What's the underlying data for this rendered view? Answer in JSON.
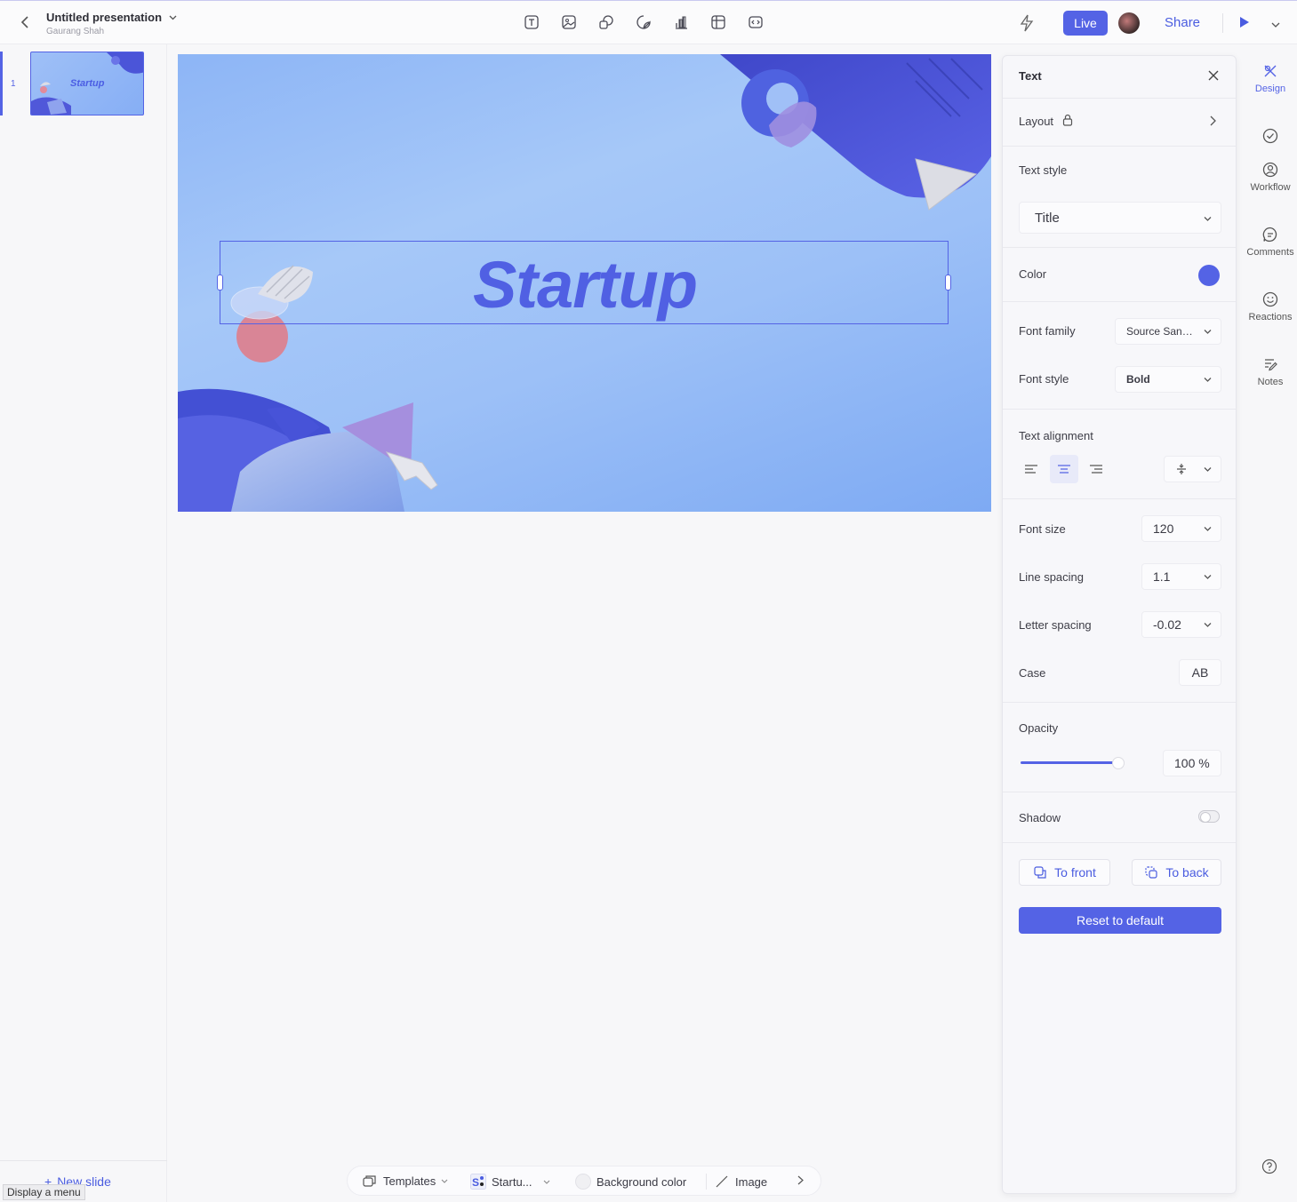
{
  "header": {
    "title": "Untitled presentation",
    "owner": "Gaurang Shah",
    "live_label": "Live",
    "share_label": "Share",
    "tools": [
      "text-icon",
      "image-icon",
      "shapes-icon",
      "sticker-icon",
      "chart-icon",
      "table-icon",
      "embed-icon"
    ]
  },
  "slides_panel": {
    "slides": [
      {
        "number": "1",
        "title": "Startup"
      }
    ],
    "new_slide_label": "New slide",
    "tooltip": "Display a menu"
  },
  "slide": {
    "title": "Startup"
  },
  "design_panel": {
    "header": "Text",
    "layout_label": "Layout",
    "text_style_label": "Text style",
    "text_style_value": "Title",
    "color_label": "Color",
    "color_value": "#5463e5",
    "font_family_label": "Font family",
    "font_family_value": "Source San…",
    "font_style_label": "Font style",
    "font_style_value": "Bold",
    "text_alignment_label": "Text alignment",
    "alignment_selected": "center",
    "font_size_label": "Font size",
    "font_size_value": "120",
    "line_spacing_label": "Line spacing",
    "line_spacing_value": "1.1",
    "letter_spacing_label": "Letter spacing",
    "letter_spacing_value": "-0.02",
    "case_label": "Case",
    "case_value": "AB",
    "opacity_label": "Opacity",
    "opacity_value": "100 %",
    "opacity_level": 1.0,
    "shadow_label": "Shadow",
    "shadow_on": false,
    "to_front_label": "To front",
    "to_back_label": "To back",
    "reset_label": "Reset to default"
  },
  "rail": {
    "design": "Design",
    "workflow": "Workflow",
    "comments": "Comments",
    "reactions": "Reactions",
    "notes": "Notes"
  },
  "bottombar": {
    "templates": "Templates",
    "theme": "Startu...",
    "background_color": "Background color",
    "image": "Image"
  },
  "colors": {
    "accent": "#5463e5",
    "slide_bg": "#9cc0f7"
  }
}
